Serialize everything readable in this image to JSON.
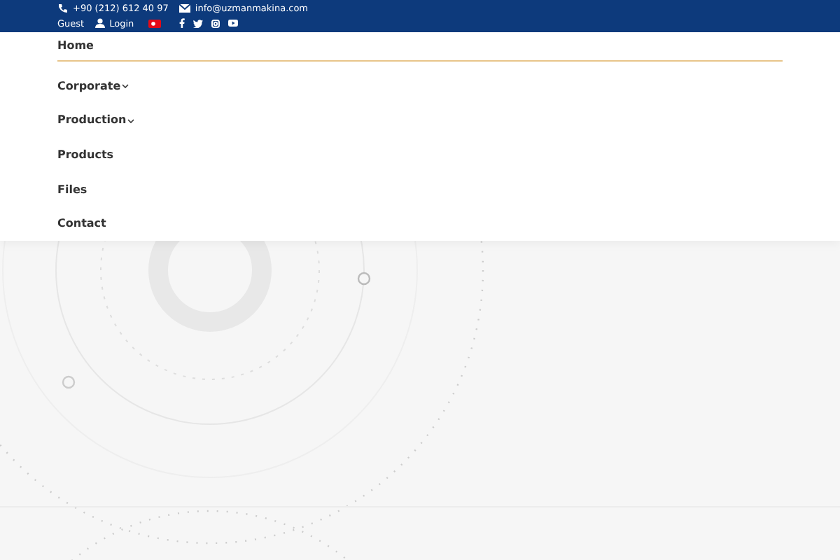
{
  "top_bar": {
    "phone": "+90 (212) 612 40 97",
    "email": "info@uzmanmakina.com",
    "user": "Guest",
    "login": "Login"
  },
  "menu": {
    "items": [
      {
        "label": "Home",
        "selected": true,
        "kind": "link"
      },
      {
        "label": "Corporate",
        "selected": false,
        "kind": "dropdown"
      },
      {
        "label": "Production",
        "selected": false,
        "kind": "dropdown"
      },
      {
        "label": "Products",
        "selected": false,
        "kind": "link"
      },
      {
        "label": "Files",
        "selected": false,
        "kind": "link"
      },
      {
        "label": "Contact",
        "selected": false,
        "kind": "link"
      }
    ]
  }
}
